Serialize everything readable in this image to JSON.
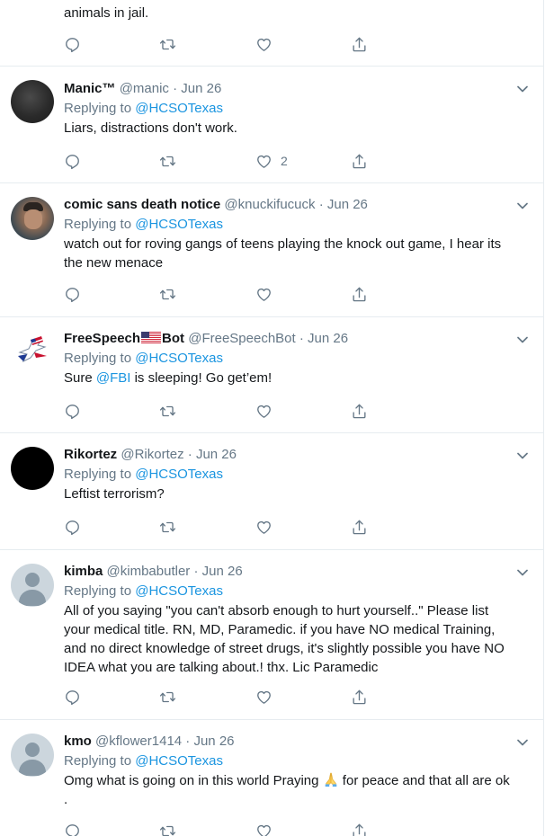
{
  "top": {
    "text_tail": "animals in jail."
  },
  "tweets": [
    {
      "name": "Manic™",
      "handle": "@manic",
      "date": "Jun 26",
      "reply_prefix": "Replying to",
      "reply_to": "@HCSOTexas",
      "text": "Liars, distractions don't work.",
      "likes": "2"
    },
    {
      "name": "comic sans death notice",
      "handle": "@knuckifucuck",
      "date": "Jun 26",
      "reply_prefix": "Replying to",
      "reply_to": "@HCSOTexas",
      "text_1": "watch out for roving gangs of teens playing the knock out game, I hear its",
      "text_2": "the new menace"
    },
    {
      "name_a": "FreeSpeech",
      "name_b": "Bot",
      "handle": "@FreeSpeechBot",
      "date": "Jun 26",
      "reply_prefix": "Replying to",
      "reply_to": "@HCSOTexas",
      "text_a": "Sure ",
      "mention": "@FBI",
      "text_b": " is sleeping! Go get’em!"
    },
    {
      "name": "Rikortez",
      "handle": "@Rikortez",
      "date": "Jun 26",
      "reply_prefix": "Replying to",
      "reply_to": "@HCSOTexas",
      "text": "Leftist terrorism?"
    },
    {
      "name": "kimba",
      "handle": "@kimbabutler",
      "date": "Jun 26",
      "reply_prefix": "Replying to",
      "reply_to": "@HCSOTexas",
      "text_1": "All of you saying \"you can't absorb enough to hurt yourself..\"  Please list",
      "text_2": "your medical title.  RN, MD, Paramedic.  if you have NO medical Training,",
      "text_3": "and no direct knowledge of street drugs, it's slightly possible you have NO",
      "text_4": "IDEA what you are talking about.!  thx. Lic Paramedic"
    },
    {
      "name": "kmo",
      "handle": "@kflower1414",
      "date": "Jun 26",
      "reply_prefix": "Replying to",
      "reply_to": "@HCSOTexas",
      "text_a": "Omg what is going on in this world Praying ",
      "text_b": " for peace and that all are ok",
      "text_2": "."
    }
  ],
  "separator": "·",
  "icons": [
    "reply-icon",
    "retweet-icon",
    "like-icon",
    "share-icon",
    "chevron-down-icon",
    "us-flag-icon",
    "praying-hands-icon"
  ]
}
